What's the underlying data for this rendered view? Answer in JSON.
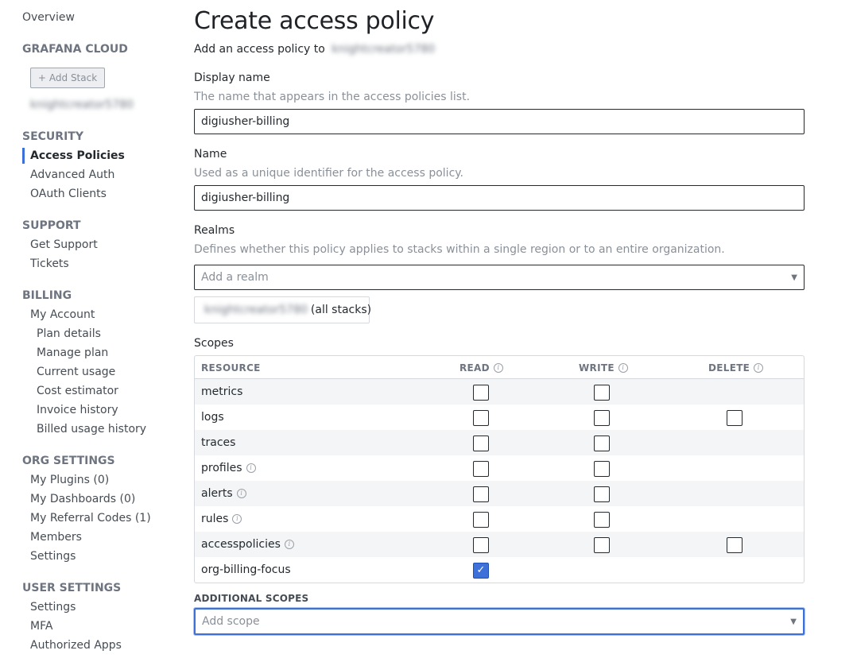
{
  "sidebar": {
    "overview": "Overview",
    "grafana_cloud": {
      "heading": "GRAFANA CLOUD",
      "add_stack": "Add Stack",
      "stack_name": "knightcreator5780"
    },
    "security": {
      "heading": "SECURITY",
      "items": [
        "Access Policies",
        "Advanced Auth",
        "OAuth Clients"
      ]
    },
    "support": {
      "heading": "SUPPORT",
      "items": [
        "Get Support",
        "Tickets"
      ]
    },
    "billing": {
      "heading": "BILLING",
      "my_account": "My Account",
      "sub_items": [
        "Plan details",
        "Manage plan",
        "Current usage",
        "Cost estimator",
        "Invoice history",
        "Billed usage history"
      ]
    },
    "org_settings": {
      "heading": "ORG SETTINGS",
      "items": [
        "My Plugins (0)",
        "My Dashboards (0)",
        "My Referral Codes (1)",
        "Members",
        "Settings"
      ]
    },
    "user_settings": {
      "heading": "USER SETTINGS",
      "items": [
        "Settings",
        "MFA",
        "Authorized Apps"
      ]
    }
  },
  "main": {
    "title": "Create access policy",
    "subtitle": "Add an access policy to",
    "subtitle_target": "knightcreator5780",
    "display_name": {
      "label": "Display name",
      "hint": "The name that appears in the access policies list.",
      "value": "digiusher-billing"
    },
    "name": {
      "label": "Name",
      "hint": "Used as a unique identifier for the access policy.",
      "value": "digiusher-billing"
    },
    "realms": {
      "label": "Realms",
      "hint": "Defines whether this policy applies to stacks within a single region or to an entire organization.",
      "placeholder": "Add a realm",
      "chip_name": "knightcreator5780",
      "chip_suffix": "(all stacks)"
    },
    "scopes": {
      "label": "Scopes",
      "headers": {
        "resource": "RESOURCE",
        "read": "READ",
        "write": "WRITE",
        "delete": "DELETE"
      },
      "rows": [
        {
          "name": "metrics",
          "info": false,
          "read": false,
          "write": false,
          "delete": null
        },
        {
          "name": "logs",
          "info": false,
          "read": false,
          "write": false,
          "delete": false
        },
        {
          "name": "traces",
          "info": false,
          "read": false,
          "write": false,
          "delete": null
        },
        {
          "name": "profiles",
          "info": true,
          "read": false,
          "write": false,
          "delete": null
        },
        {
          "name": "alerts",
          "info": true,
          "read": false,
          "write": false,
          "delete": null
        },
        {
          "name": "rules",
          "info": true,
          "read": false,
          "write": false,
          "delete": null
        },
        {
          "name": "accesspolicies",
          "info": true,
          "read": false,
          "write": false,
          "delete": false
        },
        {
          "name": "org-billing-focus",
          "info": false,
          "read": true,
          "write": null,
          "delete": null
        }
      ]
    },
    "additional_scopes": {
      "label": "ADDITIONAL SCOPES",
      "placeholder": "Add scope"
    }
  },
  "colors": {
    "accent": "#3d71d9",
    "text": "#24292e",
    "muted": "#8a9099"
  }
}
